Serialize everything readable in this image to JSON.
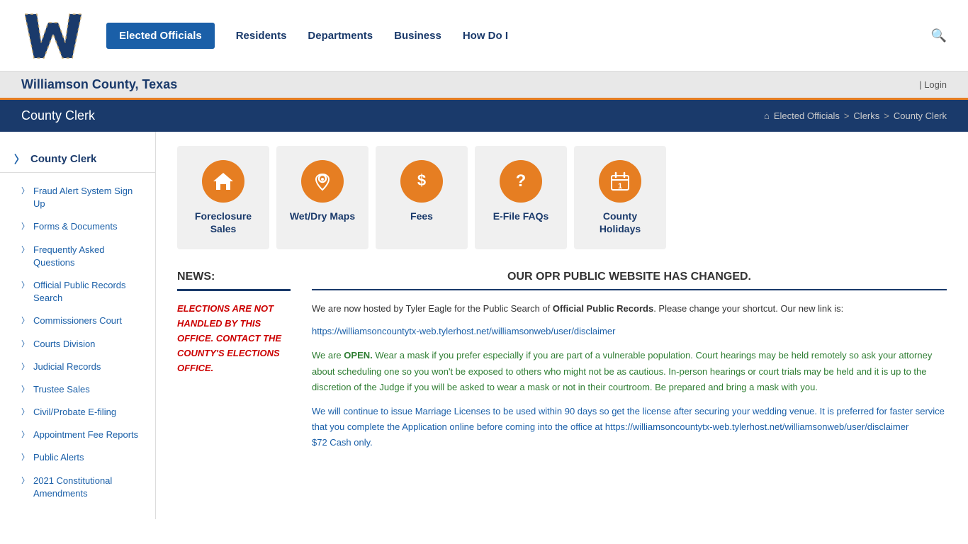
{
  "header": {
    "nav": [
      {
        "label": "Elected Officials",
        "active": true
      },
      {
        "label": "Residents",
        "active": false
      },
      {
        "label": "Departments",
        "active": false
      },
      {
        "label": "Business",
        "active": false
      },
      {
        "label": "How Do I",
        "active": false
      }
    ]
  },
  "subheader": {
    "title": "Williamson County, Texas",
    "login_text": "| Login"
  },
  "page_title_bar": {
    "title": "County Clerk",
    "breadcrumb": [
      "Elected Officials",
      "Clerks",
      "County Clerk"
    ]
  },
  "sidebar": {
    "title": "County Clerk",
    "items": [
      {
        "label": "Fraud Alert System Sign Up"
      },
      {
        "label": "Forms & Documents"
      },
      {
        "label": "Frequently Asked Questions"
      },
      {
        "label": "Official Public Records Search"
      },
      {
        "label": "Commissioners Court"
      },
      {
        "label": "Courts Division"
      },
      {
        "label": "Judicial Records"
      },
      {
        "label": "Trustee Sales"
      },
      {
        "label": "Civil/Probate E-filing"
      },
      {
        "label": "Appointment Fee Reports"
      },
      {
        "label": "Public Alerts"
      },
      {
        "label": "2021 Constitutional Amendments"
      }
    ]
  },
  "icon_cards": [
    {
      "label": "Foreclosure Sales",
      "icon": "home"
    },
    {
      "label": "Wet/Dry Maps",
      "icon": "map"
    },
    {
      "label": "Fees",
      "icon": "dollar"
    },
    {
      "label": "E-File FAQs",
      "icon": "question"
    },
    {
      "label": "County Holidays",
      "icon": "calendar"
    }
  ],
  "news": {
    "title": "NEWS:",
    "alert": "ELECTIONS ARE NOT HANDLED BY THIS OFFICE. CONTACT THE COUNTY'S ELECTIONS OFFICE."
  },
  "opr": {
    "title": "OUR OPR PUBLIC WEBSITE HAS CHANGED.",
    "intro": "We are now hosted by Tyler Eagle for the Public Search of ",
    "intro_bold": "Official Public Records",
    "intro2": ". Please change your shortcut.  Our new link is:",
    "link": "https://williamsoncountytx-web.tylerhost.net/williamsonweb/user/disclaimer",
    "open_label": "We are",
    "open_word": "OPEN.",
    "green_text": "Wear a mask if you prefer especially if you are part of a vulnerable population. Court hearings may be held remotely so ask your attorney about scheduling one so you won't be exposed to others who might not be as cautious. In-person hearings or court trials may be held and it is up to the discretion of the Judge if you will be asked to wear a mask or not in their courtroom. Be prepared and bring a mask with you.",
    "blue_text1": "We will continue to issue Marriage Licenses to be used within 90 days so get the license after securing your wedding venue. It is preferred for faster service that you complete the Application online before coming into the office at",
    "blue_link": "https://williamsoncountytx-web.tylerhost.net/williamsonweb/user/disclaimer",
    "blue_text2": "$72 Cash only."
  }
}
